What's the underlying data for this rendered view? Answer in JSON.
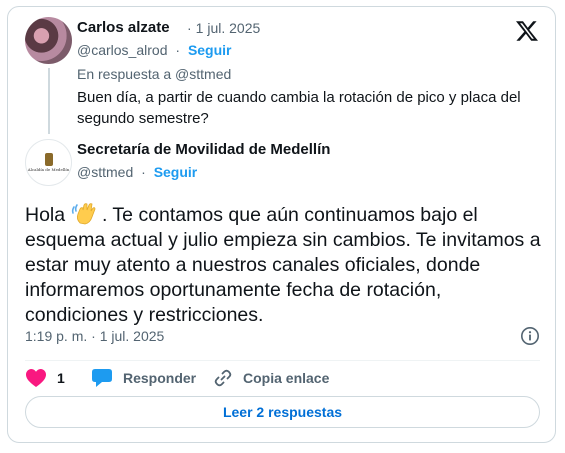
{
  "parent_tweet": {
    "author_name": "Carlos alzate",
    "date": "1 jul. 2025",
    "handle": "@carlos_alrod",
    "follow_label": "Seguir",
    "reply_to": "En respuesta a @sttmed",
    "text": "Buen día, a partir de cuando cambia la rotación de pico y placa del segundo semestre?"
  },
  "main_tweet": {
    "author_name": "Secretaría de Movilidad de Medellín",
    "handle": "@sttmed",
    "follow_label": "Seguir",
    "avatar_logo_text": "Alcaldía de Medellín",
    "text_before_emoji": "Hola ",
    "emoji": "waving-hand",
    "text_after_emoji": " .  Te contamos que aún continuamos bajo el esquema actual y julio empieza sin cambios.  Te invitamos a estar muy atento a nuestros canales oficiales, donde informaremos oportunamente fecha de rotación, condiciones y restricciones.",
    "timestamp": "1:19 p. m. · 1 jul. 2025"
  },
  "actions": {
    "like_count": "1",
    "reply_label": "Responder",
    "copy_link_label": "Copia enlace"
  },
  "read_replies_label": "Leer 2 respuestas",
  "icons": {
    "brand": "x-logo-icon",
    "like": "heart-icon",
    "reply": "speech-bubble-icon",
    "copy": "link-icon",
    "info": "info-icon"
  },
  "colors": {
    "like": "#f91880",
    "reply": "#1d9bf0",
    "link_text": "#006fd6",
    "secondary_text": "#536471",
    "border": "#cfd9de"
  }
}
